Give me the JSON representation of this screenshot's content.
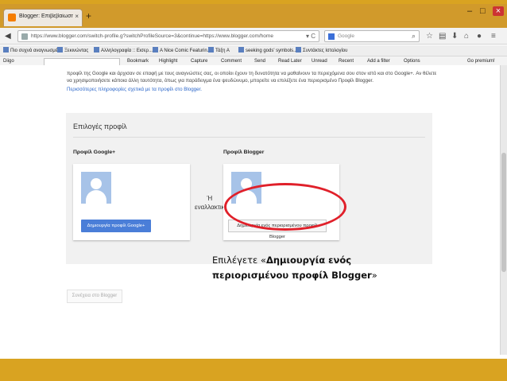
{
  "browser": {
    "tab_title": "Blogger: Επιβεβαίωση του...",
    "tab_close": "×",
    "new_tab": "+",
    "url": "https://www.blogger.com/switch-profile.g?switchProfileSource=3&continue=https://www.blogger.com/home",
    "search_placeholder": "Google",
    "window_controls": [
      "–",
      "□",
      "×"
    ]
  },
  "bookmarks": [
    "Πιο συχνά αναγνωσμέ...",
    "Ξεκινώντας",
    "Αλληλογραφία :: Εισερ...",
    "A Nice Comic Featurin...",
    "Τάξη Α",
    "seeking gods' symbols...",
    "Συντάκτες Ιστολογίου"
  ],
  "toolbar": {
    "brand": "Diigo",
    "items": [
      "Bookmark",
      "Highlight",
      "Capture",
      "Comment",
      "Send",
      "Read Later",
      "Unread",
      "Recent",
      "Add a filter",
      "Options",
      "Go premium!"
    ]
  },
  "page": {
    "intro_text": "προφίλ της Google και άρχισαν σε επαφή με τους αναγνώστες σας, οι οποίοι έχουν τη δυνατότητα να μαθαίνουν τα περιεχόμενα σου στον ιστό και στο Google+. Αν θέλετε να χρησιμοποιήσετε κάποια άλλη ταυτότητα, όπως για παράδειγμα ένα ψευδώνυμο, μπορείτε να επιλέξετε ένα περιορισμένο Προφίλ Blogger.",
    "intro_link": "Περισσότερες πληροφορίες σχετικά με τα προφίλ στο Blogger.",
    "panel_title": "Επιλογές προφίλ",
    "google_plus_title": "Προφίλ Google+",
    "blogger_title": "Προφίλ Blogger",
    "or_label_1": "Ή",
    "or_label_2": "εναλλακτικ",
    "create_google_plus": "Δημιουργία προφίλ Google+",
    "create_blogger": "Δημιουργία ενός περιορισμένου προφίλ Blogger",
    "next_button": "Συνέχεια στο Blogger"
  },
  "caption": {
    "prefix": "Επιλέγετε «",
    "bold": "Δημιουργία ενός περιορισμένου προφίλ Blogger",
    "suffix": "»"
  },
  "colors": {
    "slide_band": "#d9a321",
    "highlight_circle": "#e0202a",
    "primary_button": "#4a7ed8"
  }
}
